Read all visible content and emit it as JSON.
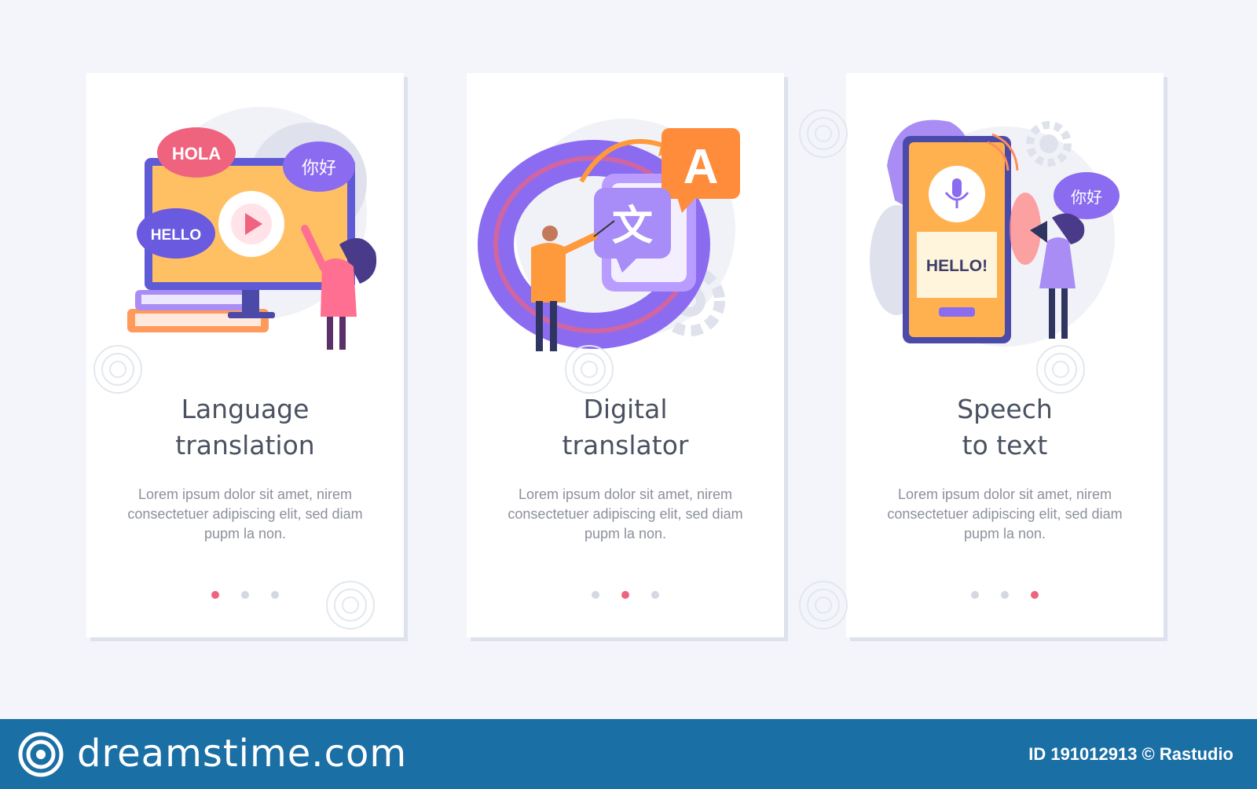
{
  "cards": [
    {
      "title_line1": "Language",
      "title_line2": "translation",
      "description": "Lorem ipsum dolor sit amet, nirem consectetuer adipiscing elit, sed diam  pupm la non.",
      "bubbles": [
        "HOLA",
        "你好",
        "HELLO"
      ],
      "active_dot": 0
    },
    {
      "title_line1": "Digital",
      "title_line2": "translator",
      "description": "Lorem ipsum dolor sit amet, nirem consectetuer adipiscing elit, sed diam  pupm la non.",
      "bubbles": [
        "A",
        "文"
      ],
      "active_dot": 1
    },
    {
      "title_line1": "Speech",
      "title_line2": "to text",
      "description": "Lorem ipsum dolor sit amet, nirem consectetuer adipiscing elit, sed diam  pupm la non.",
      "bubbles": [
        "HELLO!",
        "你好"
      ],
      "active_dot": 2
    }
  ],
  "footer": {
    "brand": "dreamstime.com",
    "stock_id": "ID 191012913 © Rastudio"
  },
  "colors": {
    "accent_pink": "#f0637f",
    "purple": "#8b6cf0",
    "orange": "#ffa94d",
    "footer_blue": "#1a6fa5"
  },
  "icons": [
    "play-icon",
    "microphone-icon",
    "gear-icon",
    "megaphone-icon",
    "dreamstime-logo-icon"
  ]
}
